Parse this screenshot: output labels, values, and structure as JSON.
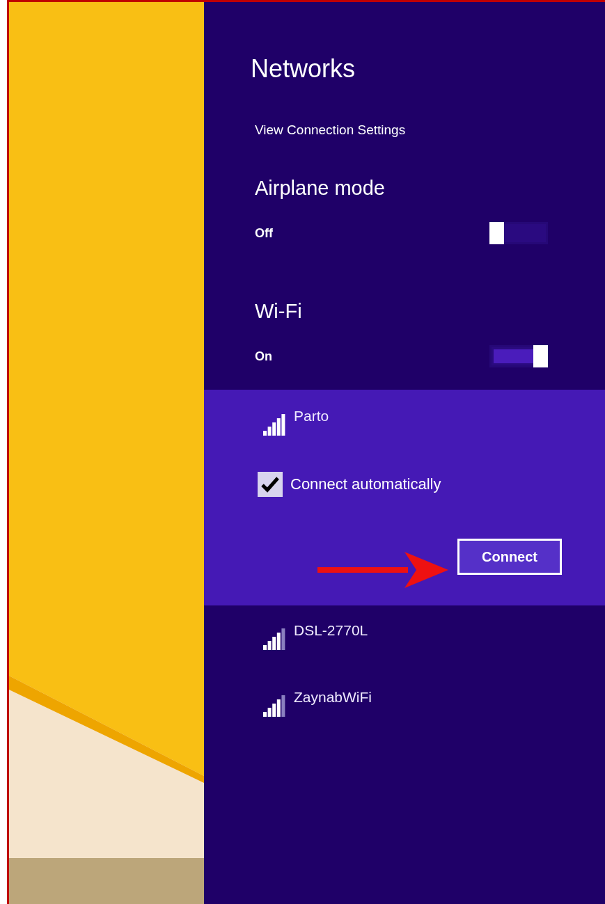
{
  "panel": {
    "title": "Networks",
    "settings_link": "View Connection Settings"
  },
  "toggles": [
    {
      "label": "Airplane mode",
      "state_text": "Off",
      "on": false
    },
    {
      "label": "Wi-Fi",
      "state_text": "On",
      "on": true
    }
  ],
  "networks": [
    {
      "name": "Parto",
      "selected": true,
      "full_signal": true,
      "connect_automatically": {
        "label": "Connect automatically",
        "checked": true
      },
      "button": "Connect"
    },
    {
      "name": "DSL-2770L",
      "selected": false,
      "full_signal": false
    },
    {
      "name": "ZaynabWiFi",
      "selected": false,
      "full_signal": false
    }
  ]
}
